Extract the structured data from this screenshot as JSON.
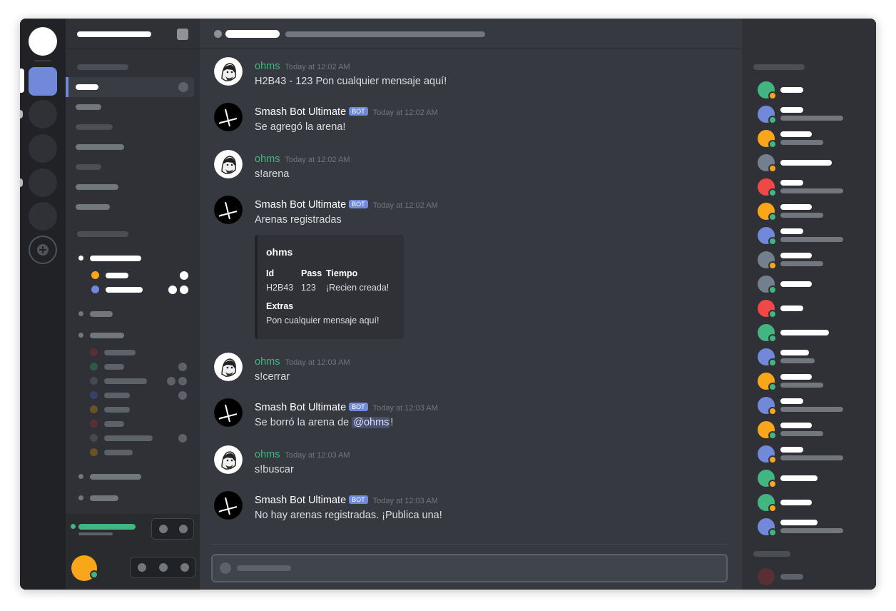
{
  "chat": {
    "messages": [
      {
        "author": "ohms",
        "bot": false,
        "timestamp": "Today at 12:02 AM",
        "text": "H2B43 - 123 Pon cualquier mensaje aquí!"
      },
      {
        "author": "Smash Bot Ultimate",
        "bot": true,
        "timestamp": "Today at 12:02 AM",
        "text": "Se agregó la arena!"
      },
      {
        "author": "ohms",
        "bot": false,
        "timestamp": "Today at 12:02 AM",
        "text": "s!arena"
      },
      {
        "author": "Smash Bot Ultimate",
        "bot": true,
        "timestamp": "Today at 12:02 AM",
        "text": "Arenas registradas"
      },
      {
        "author": "ohms",
        "bot": false,
        "timestamp": "Today at 12:03 AM",
        "text": "s!cerrar"
      },
      {
        "author": "Smash Bot Ultimate",
        "bot": true,
        "timestamp": "Today at 12:03 AM",
        "text_before": "Se borró la arena de ",
        "mention": "@ohms",
        "text_after": "!"
      },
      {
        "author": "ohms",
        "bot": false,
        "timestamp": "Today at 12:03 AM",
        "text": "s!buscar"
      },
      {
        "author": "Smash Bot Ultimate",
        "bot": true,
        "timestamp": "Today at 12:03 AM",
        "text": "No hay arenas registradas. ¡Publica una!"
      }
    ],
    "bot_badge": "BOT",
    "embed": {
      "title": "ohms",
      "fields": [
        {
          "name": "Id",
          "value": "H2B43"
        },
        {
          "name": "Pass",
          "value": "123"
        },
        {
          "name": "Tiempo",
          "value": "¡Recien creada!"
        }
      ],
      "extras_label": "Extras",
      "extras_value": "Pon cualquier mensaje aquí!"
    }
  },
  "colors": {
    "accent": "#7289da",
    "online": "#43b581",
    "idle": "#faa61a",
    "dnd": "#f04747",
    "offline": "#747f8d"
  },
  "icons": {
    "add_server": "plus-icon"
  }
}
